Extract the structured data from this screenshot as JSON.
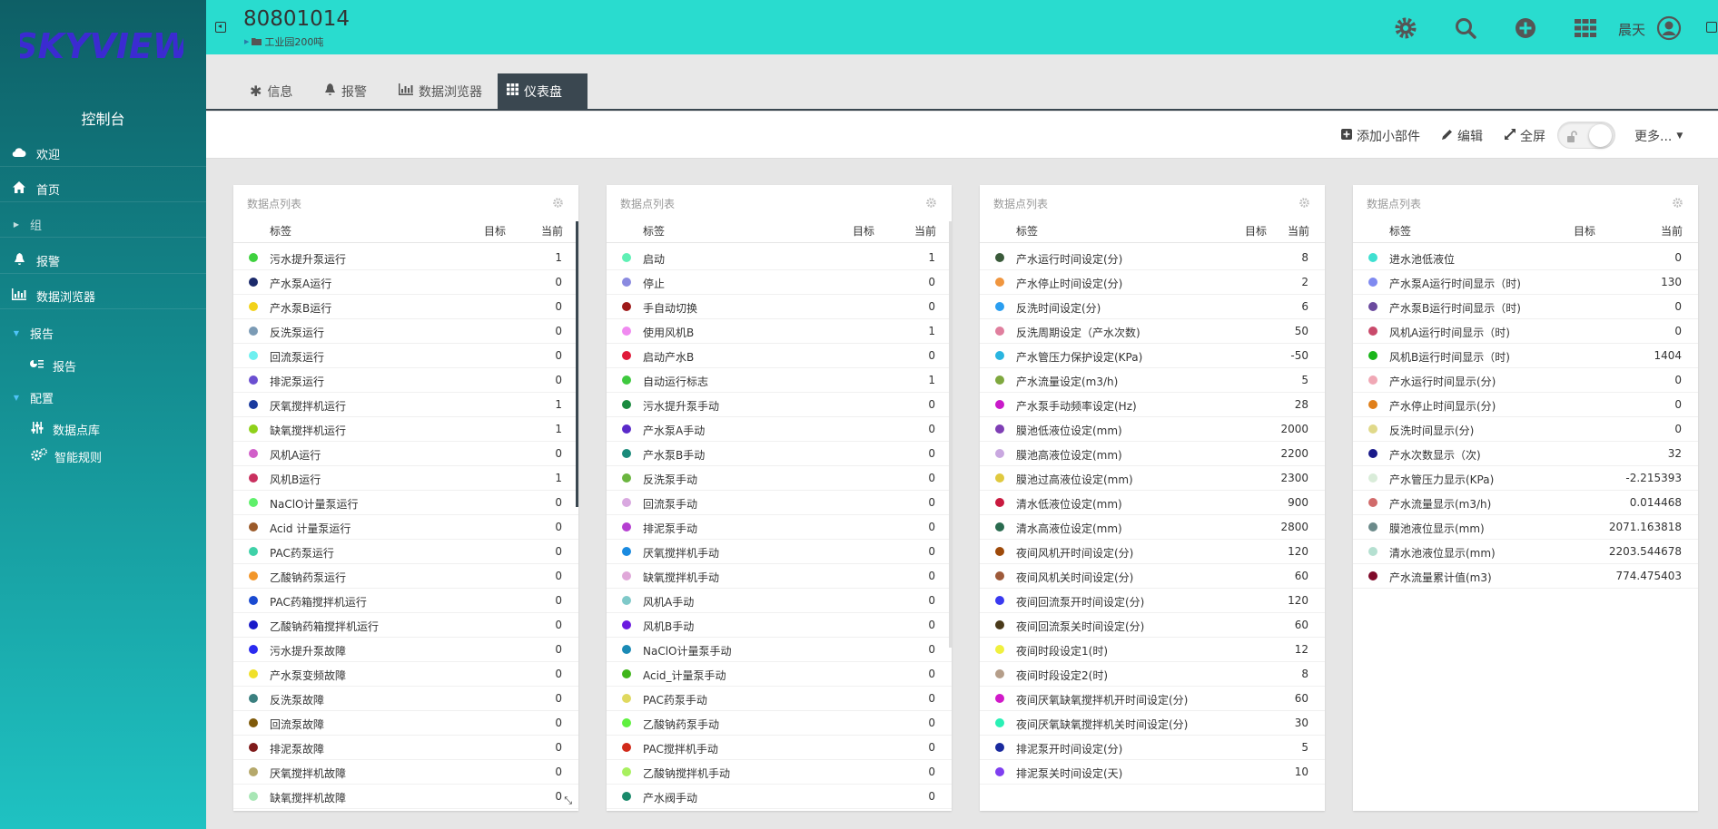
{
  "sidebar": {
    "logo_text": "SKYVIEW",
    "console_title": "控制台",
    "items": [
      {
        "label": "欢迎",
        "icon": "cloud-icon"
      },
      {
        "label": "首页",
        "icon": "home-icon"
      },
      {
        "label": "组",
        "icon": "caret-right-icon"
      },
      {
        "label": "报警",
        "icon": "bell-icon"
      },
      {
        "label": "数据浏览器",
        "icon": "bar-chart-icon"
      },
      {
        "label": "报告",
        "icon": "caret-down-icon"
      },
      {
        "label": "报告",
        "icon": "report-icon"
      },
      {
        "label": "配置",
        "icon": "caret-down-icon"
      },
      {
        "label": "数据点库",
        "icon": "sliders-icon"
      },
      {
        "label": "智能规则",
        "icon": "gears-icon"
      }
    ]
  },
  "header": {
    "device_id": "80801014",
    "breadcrumb": "工业园200吨",
    "username": "晨天"
  },
  "tabs": [
    {
      "label": "信息",
      "icon": "asterisk-icon"
    },
    {
      "label": "报警",
      "icon": "bell-icon"
    },
    {
      "label": "数据浏览器",
      "icon": "bar-chart-icon"
    },
    {
      "label": "仪表盘",
      "icon": "grid-icon"
    }
  ],
  "toolbar": {
    "add_widget": "添加小部件",
    "edit": "编辑",
    "fullscreen": "全屏",
    "more": "更多..."
  },
  "widgets": [
    {
      "title": "数据点列表",
      "col_label": "标签",
      "col_target": "目标",
      "col_current": "当前",
      "rows": [
        {
          "label": "污水提升泵运行",
          "value": "1",
          "color": "#3fd13f"
        },
        {
          "label": "产水泵A运行",
          "value": "0",
          "color": "#1b2a6b"
        },
        {
          "label": "产水泵B运行",
          "value": "0",
          "color": "#f2d21a"
        },
        {
          "label": "反洗泵运行",
          "value": "0",
          "color": "#7b9bb5"
        },
        {
          "label": "回流泵运行",
          "value": "0",
          "color": "#6ef0f0"
        },
        {
          "label": "排泥泵运行",
          "value": "0",
          "color": "#6b4fd1"
        },
        {
          "label": "厌氧搅拌机运行",
          "value": "1",
          "color": "#1a3a9e"
        },
        {
          "label": "缺氧搅拌机运行",
          "value": "1",
          "color": "#8fd11a"
        },
        {
          "label": "风机A运行",
          "value": "0",
          "color": "#d15fc9"
        },
        {
          "label": "风机B运行",
          "value": "1",
          "color": "#c9305f"
        },
        {
          "label": "NaClO计量泵运行",
          "value": "0",
          "color": "#5ff06b"
        },
        {
          "label": "Acid 计量泵运行",
          "value": "0",
          "color": "#9b5a2a"
        },
        {
          "label": "PAC药泵运行",
          "value": "0",
          "color": "#3fd1a8"
        },
        {
          "label": "乙酸钠药泵运行",
          "value": "0",
          "color": "#f2962a"
        },
        {
          "label": "PAC药箱搅拌机运行",
          "value": "0",
          "color": "#1a4ad1"
        },
        {
          "label": "乙酸钠药箱搅拌机运行",
          "value": "0",
          "color": "#1a1ac9"
        },
        {
          "label": "污水提升泵故障",
          "value": "0",
          "color": "#2a2af0"
        },
        {
          "label": "产水泵变频故障",
          "value": "0",
          "color": "#f0e02a"
        },
        {
          "label": "反洗泵故障",
          "value": "0",
          "color": "#3a7f7f"
        },
        {
          "label": "回流泵故障",
          "value": "0",
          "color": "#7f5a0a"
        },
        {
          "label": "排泥泵故障",
          "value": "0",
          "color": "#7f1a1a"
        },
        {
          "label": "厌氧搅拌机故障",
          "value": "0",
          "color": "#b5a86b"
        },
        {
          "label": "缺氧搅拌机故障",
          "value": "0",
          "color": "#a8e6b5"
        }
      ]
    },
    {
      "title": "数据点列表",
      "col_label": "标签",
      "col_target": "目标",
      "col_current": "当前",
      "rows": [
        {
          "label": "启动",
          "value": "1",
          "color": "#5ff0b5"
        },
        {
          "label": "停止",
          "value": "0",
          "color": "#8a8ae0"
        },
        {
          "label": "手自动切换",
          "value": "0",
          "color": "#9e1a1a"
        },
        {
          "label": "使用风机B",
          "value": "1",
          "color": "#f08af0"
        },
        {
          "label": "启动产水B",
          "value": "0",
          "color": "#e01a3a"
        },
        {
          "label": "自动运行标志",
          "value": "1",
          "color": "#3fc93f"
        },
        {
          "label": "污水提升泵手动",
          "value": "0",
          "color": "#1a8a3f"
        },
        {
          "label": "产水泵A手动",
          "value": "0",
          "color": "#5a2ac9"
        },
        {
          "label": "产水泵B手动",
          "value": "0",
          "color": "#1a8a7a"
        },
        {
          "label": "反洗泵手动",
          "value": "0",
          "color": "#6bb53f"
        },
        {
          "label": "回流泵手动",
          "value": "0",
          "color": "#d9a8e0"
        },
        {
          "label": "排泥泵手动",
          "value": "0",
          "color": "#b53fd1"
        },
        {
          "label": "厌氧搅拌机手动",
          "value": "0",
          "color": "#1a8ae0"
        },
        {
          "label": "缺氧搅拌机手动",
          "value": "0",
          "color": "#e0a8d9"
        },
        {
          "label": "风机A手动",
          "value": "0",
          "color": "#7fc9c9"
        },
        {
          "label": "风机B手动",
          "value": "0",
          "color": "#6b1ae0"
        },
        {
          "label": "NaClO计量泵手动",
          "value": "0",
          "color": "#1a8ab5"
        },
        {
          "label": "Acid_计量泵手动",
          "value": "0",
          "color": "#3fb51a"
        },
        {
          "label": "PAC药泵手动",
          "value": "0",
          "color": "#e0d95f"
        },
        {
          "label": "乙酸钠药泵手动",
          "value": "0",
          "color": "#5ff03f"
        },
        {
          "label": "PAC搅拌机手动",
          "value": "0",
          "color": "#d12a1a"
        },
        {
          "label": "乙酸钠搅拌机手动",
          "value": "0",
          "color": "#a8f05f"
        },
        {
          "label": "产水阀手动",
          "value": "0",
          "color": "#1a8a6b"
        }
      ]
    },
    {
      "title": "数据点列表",
      "col_label": "标签",
      "col_target": "目标",
      "col_current": "当前",
      "rows": [
        {
          "label": "产水运行时间设定(分)",
          "value": "8",
          "color": "#3a5a3a"
        },
        {
          "label": "产水停止时间设定(分)",
          "value": "2",
          "color": "#f0963f"
        },
        {
          "label": "反洗时间设定(分)",
          "value": "6",
          "color": "#2a9ef0"
        },
        {
          "label": "反洗周期设定（产水次数)",
          "value": "50",
          "color": "#e07f9e"
        },
        {
          "label": "产水管压力保护设定(KPa)",
          "value": "-50",
          "color": "#2ab5e0"
        },
        {
          "label": "产水流量设定(m3/h)",
          "value": "5",
          "color": "#7fa83f"
        },
        {
          "label": "产水泵手动频率设定(Hz)",
          "value": "28",
          "color": "#c91ac9"
        },
        {
          "label": "膜池低液位设定(mm)",
          "value": "2000",
          "color": "#7f3fb5"
        },
        {
          "label": "膜池高液位设定(mm)",
          "value": "2200",
          "color": "#c9a8e0"
        },
        {
          "label": "膜池过高液位设定(mm)",
          "value": "2300",
          "color": "#e0c93f"
        },
        {
          "label": "清水低液位设定(mm)",
          "value": "900",
          "color": "#c91a3f"
        },
        {
          "label": "清水高液位设定(mm)",
          "value": "2800",
          "color": "#2a6b4f"
        },
        {
          "label": "夜间风机开时间设定(分)",
          "value": "120",
          "color": "#9e4a0a"
        },
        {
          "label": "夜间风机关时间设定(分)",
          "value": "60",
          "color": "#9e5a3a"
        },
        {
          "label": "夜间回流泵开时间设定(分)",
          "value": "120",
          "color": "#3a3af0"
        },
        {
          "label": "夜间回流泵关时间设定(分)",
          "value": "60",
          "color": "#4a3a1a"
        },
        {
          "label": "夜间时段设定1(时)",
          "value": "12",
          "color": "#f0f03f"
        },
        {
          "label": "夜间时段设定2(时)",
          "value": "8",
          "color": "#b59e8a"
        },
        {
          "label": "夜间厌氧缺氧搅拌机开时间设定(分)",
          "value": "60",
          "color": "#d11ac9"
        },
        {
          "label": "夜间厌氧缺氧搅拌机关时间设定(分)",
          "value": "30",
          "color": "#2af0b5"
        },
        {
          "label": "排泥泵开时间设定(分)",
          "value": "5",
          "color": "#1a2a9e"
        },
        {
          "label": "排泥泵关时间设定(天)",
          "value": "10",
          "color": "#7f3ff0"
        }
      ]
    },
    {
      "title": "数据点列表",
      "col_label": "标签",
      "col_target": "目标",
      "col_current": "当前",
      "rows": [
        {
          "label": "进水池低液位",
          "value": "0",
          "color": "#3fe0d1"
        },
        {
          "label": "产水泵A运行时间显示（时)",
          "value": "130",
          "color": "#7f8af0"
        },
        {
          "label": "产水泵B运行时间显示（时)",
          "value": "0",
          "color": "#6b4a9e"
        },
        {
          "label": "风机A运行时间显示（时)",
          "value": "0",
          "color": "#c94a6b"
        },
        {
          "label": "风机B运行时间显示（时)",
          "value": "1404",
          "color": "#1ab51a"
        },
        {
          "label": "产水运行时间显示(分)",
          "value": "0",
          "color": "#f0a8b5"
        },
        {
          "label": "产水停止时间显示(分)",
          "value": "0",
          "color": "#e07f1a"
        },
        {
          "label": "反洗时间显示(分)",
          "value": "0",
          "color": "#e0d98a"
        },
        {
          "label": "产水次数显示（次)",
          "value": "32",
          "color": "#1a1a8a"
        },
        {
          "label": "产水管压力显示(KPa)",
          "value": "-2.215393",
          "color": "#d9ecd9"
        },
        {
          "label": "产水流量显示(m3/h)",
          "value": "0.014468",
          "color": "#d16b6b"
        },
        {
          "label": "膜池液位显示(mm)",
          "value": "2071.163818",
          "color": "#6b8a8a"
        },
        {
          "label": "清水池液位显示(mm)",
          "value": "2203.544678",
          "color": "#b5e0d1"
        },
        {
          "label": "产水流量累计值(m3)",
          "value": "774.475403",
          "color": "#7f0a2a"
        }
      ]
    }
  ]
}
